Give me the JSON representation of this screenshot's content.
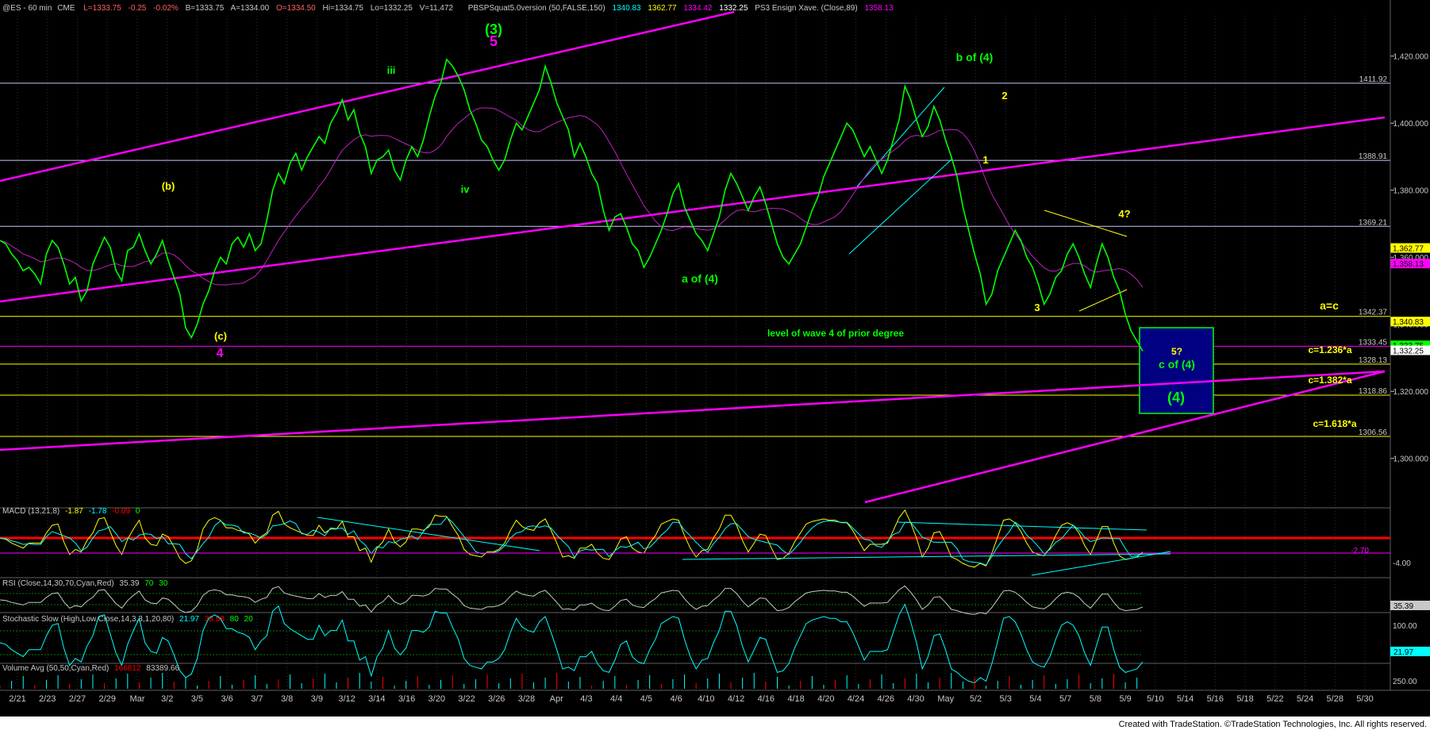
{
  "header": {
    "symbol": "@ES - 60 min",
    "exchange": "CME",
    "last": "L=1333.75",
    "change": "-0.25",
    "pct_change": "-0.02%",
    "bid": "B=1333.75",
    "ask": "A=1334.00",
    "open": "O=1334.50",
    "high": "Hi=1334.75",
    "low": "Lo=1332.25",
    "volume": "V=11,472",
    "study1_name": "PBSPSquat5.0version (50,FALSE,150)",
    "study1_v1": "1340.83",
    "study1_v2": "1362.77",
    "study1_v3": "1334.42",
    "study1_v4": "1332.25",
    "study2_name": "PS3 Ensign Xave. (Close,89)",
    "study2_v1": "1358.13"
  },
  "colors": {
    "background": "#000000",
    "price": "#00ff00",
    "channel": "#ff00ff",
    "hline": "#c8c8ff",
    "yellow": "#ffff00",
    "zone_fill": "#000080",
    "macd_line": "#ffff00",
    "macd_signal": "#00ffff",
    "macd_hist": "#ff0000",
    "rsi": "#c8c8c8"
  },
  "chart_data": {
    "type": "line",
    "title": "@ES - 60 min",
    "y_axis": {
      "ylim": [
        1290,
        1432
      ],
      "ticks": [
        1300,
        1320,
        1340,
        1360,
        1380,
        1400,
        1420
      ]
    },
    "x_labels": [
      "2/21",
      "2/23",
      "2/27",
      "2/29",
      "Mar",
      "3/2",
      "3/5",
      "3/6",
      "3/7",
      "3/8",
      "3/9",
      "3/12",
      "3/14",
      "3/16",
      "3/20",
      "3/22",
      "3/26",
      "3/28",
      "Apr",
      "4/3",
      "4/4",
      "4/5",
      "4/6",
      "4/10",
      "4/12",
      "4/16",
      "4/18",
      "4/20",
      "4/24",
      "4/26",
      "4/30",
      "May",
      "5/2",
      "5/3",
      "5/4",
      "5/7",
      "5/8",
      "5/9",
      "5/10",
      "5/14",
      "5/16",
      "5/18",
      "5/22",
      "5/24",
      "5/28",
      "5/30"
    ],
    "price_path": [
      [
        0,
        1365
      ],
      [
        2,
        1364
      ],
      [
        4,
        1361
      ],
      [
        6,
        1359
      ],
      [
        8,
        1356
      ],
      [
        10,
        1357
      ],
      [
        12,
        1355
      ],
      [
        14,
        1352
      ],
      [
        16,
        1361
      ],
      [
        18,
        1365
      ],
      [
        20,
        1363
      ],
      [
        22,
        1358
      ],
      [
        24,
        1352
      ],
      [
        26,
        1354
      ],
      [
        28,
        1347
      ],
      [
        30,
        1350
      ],
      [
        32,
        1358
      ],
      [
        34,
        1362
      ],
      [
        36,
        1366
      ],
      [
        38,
        1363
      ],
      [
        40,
        1356
      ],
      [
        42,
        1353
      ],
      [
        44,
        1362
      ],
      [
        46,
        1363
      ],
      [
        48,
        1367
      ],
      [
        50,
        1362
      ],
      [
        52,
        1358
      ],
      [
        54,
        1361
      ],
      [
        56,
        1365
      ],
      [
        58,
        1359
      ],
      [
        60,
        1354
      ],
      [
        62,
        1349
      ],
      [
        64,
        1339
      ],
      [
        66,
        1336
      ],
      [
        68,
        1340
      ],
      [
        70,
        1346
      ],
      [
        72,
        1350
      ],
      [
        74,
        1356
      ],
      [
        76,
        1360
      ],
      [
        78,
        1358
      ],
      [
        80,
        1364
      ],
      [
        82,
        1366
      ],
      [
        84,
        1363
      ],
      [
        86,
        1367
      ],
      [
        88,
        1362
      ],
      [
        90,
        1364
      ],
      [
        92,
        1371
      ],
      [
        94,
        1380
      ],
      [
        96,
        1385
      ],
      [
        98,
        1382
      ],
      [
        100,
        1388
      ],
      [
        102,
        1391
      ],
      [
        104,
        1386
      ],
      [
        106,
        1390
      ],
      [
        108,
        1393
      ],
      [
        110,
        1396
      ],
      [
        112,
        1394
      ],
      [
        114,
        1400
      ],
      [
        116,
        1403
      ],
      [
        118,
        1407
      ],
      [
        120,
        1401
      ],
      [
        122,
        1404
      ],
      [
        124,
        1397
      ],
      [
        126,
        1393
      ],
      [
        128,
        1385
      ],
      [
        130,
        1389
      ],
      [
        132,
        1390
      ],
      [
        134,
        1392
      ],
      [
        136,
        1386
      ],
      [
        138,
        1383
      ],
      [
        140,
        1389
      ],
      [
        142,
        1393
      ],
      [
        144,
        1390
      ],
      [
        146,
        1395
      ],
      [
        148,
        1402
      ],
      [
        150,
        1408
      ],
      [
        152,
        1412
      ],
      [
        154,
        1419
      ],
      [
        156,
        1417
      ],
      [
        158,
        1414
      ],
      [
        160,
        1410
      ],
      [
        162,
        1404
      ],
      [
        164,
        1400
      ],
      [
        166,
        1395
      ],
      [
        168,
        1393
      ],
      [
        170,
        1389
      ],
      [
        172,
        1386
      ],
      [
        174,
        1389
      ],
      [
        176,
        1395
      ],
      [
        178,
        1400
      ],
      [
        180,
        1398
      ],
      [
        182,
        1402
      ],
      [
        184,
        1406
      ],
      [
        186,
        1410
      ],
      [
        188,
        1417
      ],
      [
        190,
        1412
      ],
      [
        192,
        1406
      ],
      [
        194,
        1402
      ],
      [
        196,
        1398
      ],
      [
        198,
        1390
      ],
      [
        200,
        1394
      ],
      [
        202,
        1390
      ],
      [
        204,
        1385
      ],
      [
        206,
        1382
      ],
      [
        208,
        1374
      ],
      [
        210,
        1368
      ],
      [
        212,
        1372
      ],
      [
        214,
        1373
      ],
      [
        216,
        1369
      ],
      [
        218,
        1364
      ],
      [
        220,
        1362
      ],
      [
        222,
        1357
      ],
      [
        224,
        1360
      ],
      [
        226,
        1364
      ],
      [
        228,
        1368
      ],
      [
        230,
        1373
      ],
      [
        232,
        1379
      ],
      [
        234,
        1382
      ],
      [
        236,
        1375
      ],
      [
        238,
        1371
      ],
      [
        240,
        1367
      ],
      [
        242,
        1365
      ],
      [
        244,
        1362
      ],
      [
        246,
        1367
      ],
      [
        248,
        1372
      ],
      [
        250,
        1380
      ],
      [
        252,
        1385
      ],
      [
        254,
        1382
      ],
      [
        256,
        1378
      ],
      [
        258,
        1374
      ],
      [
        260,
        1378
      ],
      [
        262,
        1381
      ],
      [
        264,
        1376
      ],
      [
        266,
        1370
      ],
      [
        268,
        1364
      ],
      [
        270,
        1360
      ],
      [
        272,
        1358
      ],
      [
        274,
        1361
      ],
      [
        276,
        1364
      ],
      [
        278,
        1369
      ],
      [
        280,
        1374
      ],
      [
        282,
        1378
      ],
      [
        284,
        1384
      ],
      [
        286,
        1388
      ],
      [
        288,
        1392
      ],
      [
        290,
        1396
      ],
      [
        292,
        1400
      ],
      [
        294,
        1398
      ],
      [
        296,
        1394
      ],
      [
        298,
        1390
      ],
      [
        300,
        1393
      ],
      [
        302,
        1389
      ],
      [
        304,
        1385
      ],
      [
        306,
        1389
      ],
      [
        308,
        1395
      ],
      [
        310,
        1401
      ],
      [
        312,
        1411
      ],
      [
        314,
        1407
      ],
      [
        316,
        1401
      ],
      [
        318,
        1396
      ],
      [
        320,
        1399
      ],
      [
        322,
        1405
      ],
      [
        324,
        1401
      ],
      [
        326,
        1395
      ],
      [
        328,
        1390
      ],
      [
        330,
        1384
      ],
      [
        332,
        1375
      ],
      [
        334,
        1368
      ],
      [
        336,
        1361
      ],
      [
        338,
        1355
      ],
      [
        340,
        1346
      ],
      [
        342,
        1349
      ],
      [
        344,
        1356
      ],
      [
        346,
        1360
      ],
      [
        348,
        1364
      ],
      [
        350,
        1368
      ],
      [
        352,
        1365
      ],
      [
        354,
        1360
      ],
      [
        356,
        1357
      ],
      [
        358,
        1352
      ],
      [
        360,
        1346
      ],
      [
        362,
        1349
      ],
      [
        364,
        1354
      ],
      [
        366,
        1356
      ],
      [
        368,
        1361
      ],
      [
        370,
        1364
      ],
      [
        372,
        1360
      ],
      [
        374,
        1355
      ],
      [
        376,
        1351
      ],
      [
        378,
        1358
      ],
      [
        380,
        1364
      ],
      [
        382,
        1360
      ],
      [
        384,
        1354
      ],
      [
        386,
        1350
      ],
      [
        388,
        1343
      ],
      [
        390,
        1338
      ],
      [
        392,
        1335
      ],
      [
        394,
        1332
      ]
    ],
    "series": [
      {
        "name": "MACD (13,21,8)",
        "values": [
          -1.87,
          -1.78,
          -0.09,
          0.0
        ]
      },
      {
        "name": "RSI (Close,14,30,70,Cyan,Red)",
        "values": [
          35.39,
          70.0,
          30.0
        ]
      },
      {
        "name": "Stochastic Slow (High,Low,Close,14,3,3,1,20,80)",
        "values": [
          21.97,
          38.58,
          80.0,
          20.0
        ]
      },
      {
        "name": "Volume Avg (50,50,Cyan,Red)",
        "values": [
          166812.0,
          83389.66
        ]
      }
    ],
    "hlines": [
      {
        "value": 1411.92,
        "label": "1411.92",
        "color": "#c8c8ff"
      },
      {
        "value": 1388.91,
        "label": "1388.91",
        "color": "#c8c8ff"
      },
      {
        "value": 1369.21,
        "label": "1369.21",
        "color": "#c8c8ff"
      },
      {
        "value": 1342.37,
        "label": "1342.37",
        "color": "#ffff00"
      },
      {
        "value": 1333.45,
        "label": "1333.45",
        "color": "#ff00ff"
      },
      {
        "value": 1328.13,
        "label": "1328.13",
        "color": "#ffff00"
      },
      {
        "value": 1318.86,
        "label": "1318.86",
        "color": "#ffff00"
      },
      {
        "value": 1306.56,
        "label": "1306.56",
        "color": "#ffff00"
      }
    ],
    "price_badges": [
      {
        "value": 1362.77,
        "label": "1,362.77",
        "bg": "#ffff00"
      },
      {
        "value": 1358.13,
        "label": "1,358.13",
        "bg": "#ff00ff"
      },
      {
        "value": 1340.83,
        "label": "1,340.83",
        "bg": "#ffff00"
      },
      {
        "value": 1333.75,
        "label": "1,333.75",
        "bg": "#00ff00"
      },
      {
        "value": 1332.25,
        "label": "1,332.25",
        "bg": "#ffffff"
      }
    ],
    "annotations_primary": [
      {
        "text": "(3)",
        "color": "#00ff00"
      },
      {
        "text": "5",
        "color": "#ff00ff"
      },
      {
        "text": "4",
        "color": "#ff00ff"
      },
      {
        "text": "(c)",
        "color": "#ffff00"
      },
      {
        "text": "(b)",
        "color": "#ffff00"
      },
      {
        "text": "iii",
        "color": "#00ff00"
      },
      {
        "text": "iv",
        "color": "#00ff00"
      },
      {
        "text": "a of (4)",
        "color": "#00ff00"
      },
      {
        "text": "b of (4)",
        "color": "#00ff00"
      },
      {
        "text": "1",
        "color": "#ffff00"
      },
      {
        "text": "2",
        "color": "#ffff00"
      },
      {
        "text": "3",
        "color": "#ffff00"
      },
      {
        "text": "4?",
        "color": "#ffff00"
      },
      {
        "text": "a=c",
        "color": "#ffff00"
      },
      {
        "text": "5?",
        "color": "#ffff00"
      },
      {
        "text": "c of (4)",
        "color": "#00ff00"
      },
      {
        "text": "(4)",
        "color": "#00ff00"
      },
      {
        "text": "c=1.236*a",
        "color": "#ffff00"
      },
      {
        "text": "c=1.382*a",
        "color": "#ffff00"
      },
      {
        "text": "c=1.618*a",
        "color": "#ffff00"
      },
      {
        "text": "level of wave 4 of prior degree",
        "color": "#00ff00"
      }
    ],
    "indicator_axis_labels": [
      "-2.70",
      "-4.00",
      "35.39",
      "100.00",
      "21.97",
      "250.00"
    ]
  },
  "footer_text": "Created with TradeStation. ©TradeStation Technologies, Inc. All rights reserved."
}
